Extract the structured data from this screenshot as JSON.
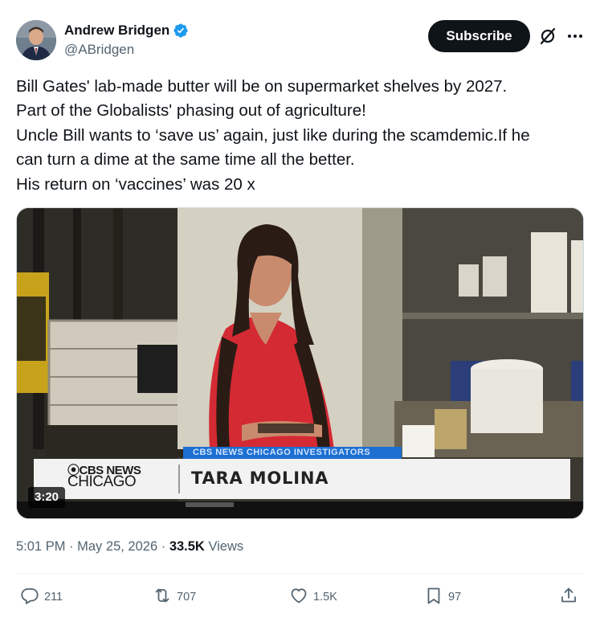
{
  "author": {
    "display_name": "Andrew Bridgen",
    "handle": "@ABridgen",
    "verified_icon": "verified-badge-icon"
  },
  "header": {
    "subscribe_label": "Subscribe",
    "grok_icon": "grok-icon",
    "more_icon": "more-options-icon"
  },
  "tweet": {
    "lines": [
      "Bill Gates' lab-made butter will be on supermarket shelves by 2027.",
      "Part of the Globalists' phasing out of agriculture!",
      "Uncle Bill wants to ‘save us’ again, just like during the scamdemic.If he",
      "can turn a dime at the same time all the better.",
      "His return on ‘vaccines’ was 20 x"
    ]
  },
  "media": {
    "type": "video",
    "duration": "3:20",
    "chyron": {
      "tag": "CBS NEWS CHICAGO INVESTIGATORS",
      "logo_top": "⦿CBS NEWS",
      "logo_bottom": "CHICAGO",
      "name": "TARA MOLINA"
    }
  },
  "meta": {
    "time": "5:01 PM",
    "date": "May 25, 2026",
    "separator": "·",
    "views_count": "33.5K",
    "views_label": "Views"
  },
  "actions": {
    "replies": "211",
    "reposts": "707",
    "likes": "1.5K",
    "bookmarks": "97"
  },
  "colors": {
    "text": "#0f1419",
    "secondary": "#536471",
    "verified": "#1d9bf0",
    "subscribe_bg": "#0f1419",
    "chyron_blue": "#1d6fd1"
  }
}
